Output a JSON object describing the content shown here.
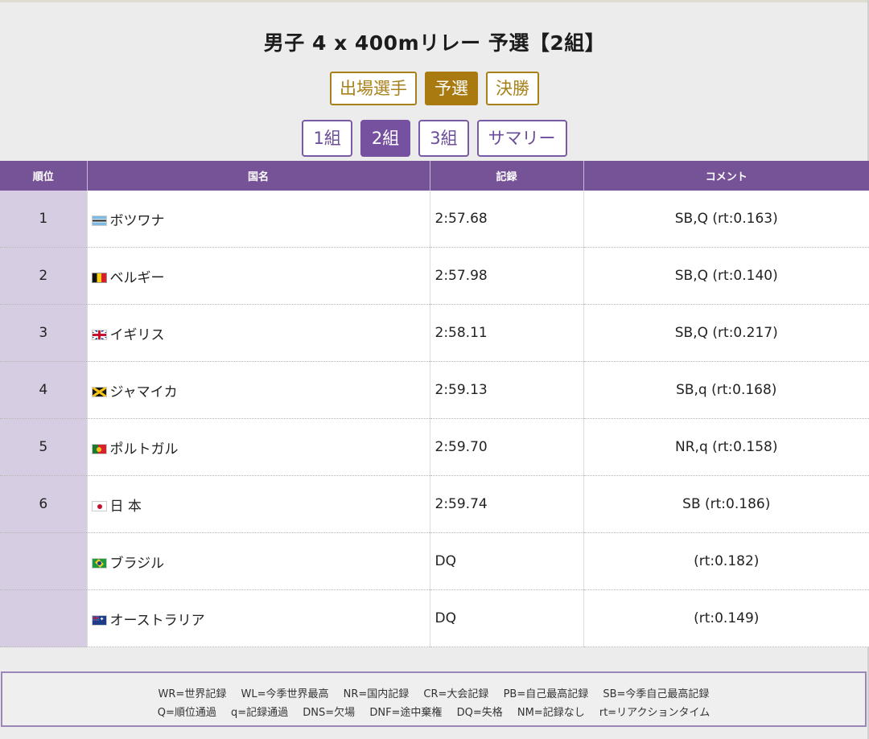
{
  "page": {
    "title": "男子 4 x 400mリレー 予選【2組】"
  },
  "stage_tabs": [
    {
      "label": "出場選手",
      "active": false
    },
    {
      "label": "予選",
      "active": true
    },
    {
      "label": "決勝",
      "active": false
    }
  ],
  "heat_tabs": [
    {
      "label": "1組",
      "active": false
    },
    {
      "label": "2組",
      "active": true
    },
    {
      "label": "3組",
      "active": false
    },
    {
      "label": "サマリー",
      "active": false
    }
  ],
  "table": {
    "headers": {
      "rank": "順位",
      "country": "国名",
      "record": "記録",
      "comment": "コメント"
    },
    "rows": [
      {
        "rank": "1",
        "flag": "botswana-flag-icon",
        "country": "ボツワナ",
        "record": "2:57.68",
        "comment": "SB,Q (rt:0.163)"
      },
      {
        "rank": "2",
        "flag": "belgium-flag-icon",
        "country": "ベルギー",
        "record": "2:57.98",
        "comment": "SB,Q (rt:0.140)"
      },
      {
        "rank": "3",
        "flag": "uk-flag-icon",
        "country": "イギリス",
        "record": "2:58.11",
        "comment": "SB,Q (rt:0.217)"
      },
      {
        "rank": "4",
        "flag": "jamaica-flag-icon",
        "country": "ジャマイカ",
        "record": "2:59.13",
        "comment": "SB,q (rt:0.168)"
      },
      {
        "rank": "5",
        "flag": "portugal-flag-icon",
        "country": "ポルトガル",
        "record": "2:59.70",
        "comment": "NR,q (rt:0.158)"
      },
      {
        "rank": "6",
        "flag": "japan-flag-icon",
        "country": "日 本",
        "record": "2:59.74",
        "comment": "SB (rt:0.186)"
      },
      {
        "rank": "",
        "flag": "brazil-flag-icon",
        "country": "ブラジル",
        "record": "DQ",
        "comment": "(rt:0.182)"
      },
      {
        "rank": "",
        "flag": "australia-flag-icon",
        "country": "オーストラリア",
        "record": "DQ",
        "comment": "(rt:0.149)"
      }
    ]
  },
  "legend": {
    "line1": [
      "WR=世界記録",
      "WL=今季世界最高",
      "NR=国内記録",
      "CR=大会記録",
      "PB=自己最高記録",
      "SB=今季自己最高記録"
    ],
    "line2": [
      "Q=順位通過",
      "q=記録通過",
      "DNS=欠場",
      "DNF=途中棄権",
      "DQ=失格",
      "NM=記録なし",
      "rt=リアクションタイム"
    ]
  },
  "colors": {
    "accent_gold": "#a87a10",
    "accent_purple": "#765397",
    "rank_cell_bg": "#d6cde3"
  }
}
